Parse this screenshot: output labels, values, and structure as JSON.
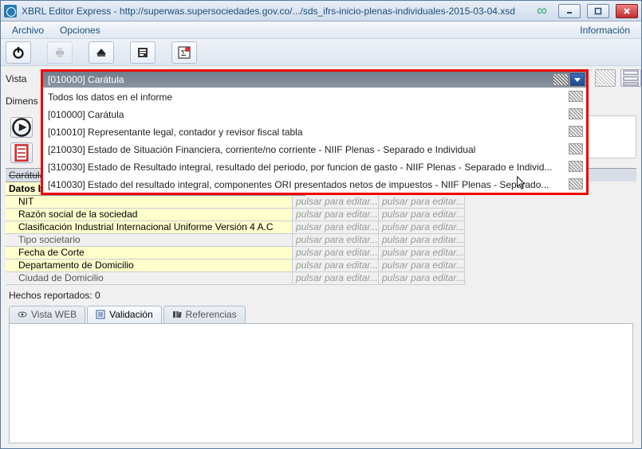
{
  "window": {
    "title": "XBRL Editor Express - http://superwas.supersociedades.gov.co/.../sds_ifrs-inicio-plenas-individuales-2015-03-04.xsd"
  },
  "menubar": {
    "archivo": "Archivo",
    "opciones": "Opciones",
    "informacion": "Información"
  },
  "labels": {
    "vista": "Vista",
    "dimens": "Dimens"
  },
  "combo": {
    "selected": "[010000] Carátula",
    "options": [
      "Todos los datos en el informe",
      "[010000] Carátula",
      "[010010] Representante legal, contador y revisor fiscal tabla",
      "[210030] Estado de Situación Financiera, corriente/no corriente - NIIF Plenas - Separado e Individual",
      "[310030] Estado de Resultado integral, resultado del periodo, por funcion de gasto - NIIF Plenas - Separado e Individ...",
      "[410030] Estado del resultado integral, componentes ORI presentados netos de impuestos - NIIF Plenas - Separado..."
    ]
  },
  "grid": {
    "section_title": "Carátula [sinopsis]",
    "subheader": "Datos básicos",
    "placeholder": "pulsar para editar...",
    "rows": [
      {
        "label": "NIT",
        "yellow": true
      },
      {
        "label": "Razón social de la sociedad",
        "yellow": true
      },
      {
        "label": "Clasificación Industrial Internacional Uniforme Versión 4 A.C",
        "yellow": true
      },
      {
        "label": "Tipo societario",
        "yellow": false
      },
      {
        "label": "Fecha de Corte",
        "yellow": true
      },
      {
        "label": "Departamento de Domicilio",
        "yellow": true
      },
      {
        "label": "Ciudad de Domicilio",
        "yellow": false
      }
    ]
  },
  "status": {
    "text": "Hechos reportados: 0"
  },
  "tabs": {
    "web": "Vista WEB",
    "validacion": "Validación",
    "referencias": "Referencias"
  }
}
